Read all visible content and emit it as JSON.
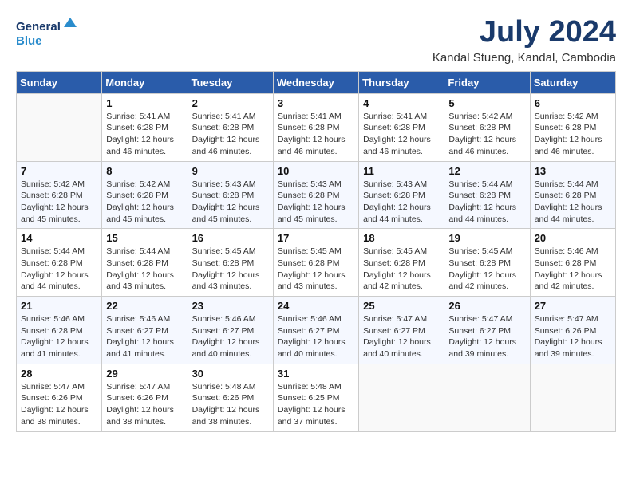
{
  "header": {
    "logo_line1": "General",
    "logo_line2": "Blue",
    "month_year": "July 2024",
    "location": "Kandal Stueng, Kandal, Cambodia"
  },
  "days_of_week": [
    "Sunday",
    "Monday",
    "Tuesday",
    "Wednesday",
    "Thursday",
    "Friday",
    "Saturday"
  ],
  "weeks": [
    [
      {
        "day": "",
        "info": ""
      },
      {
        "day": "1",
        "info": "Sunrise: 5:41 AM\nSunset: 6:28 PM\nDaylight: 12 hours\nand 46 minutes."
      },
      {
        "day": "2",
        "info": "Sunrise: 5:41 AM\nSunset: 6:28 PM\nDaylight: 12 hours\nand 46 minutes."
      },
      {
        "day": "3",
        "info": "Sunrise: 5:41 AM\nSunset: 6:28 PM\nDaylight: 12 hours\nand 46 minutes."
      },
      {
        "day": "4",
        "info": "Sunrise: 5:41 AM\nSunset: 6:28 PM\nDaylight: 12 hours\nand 46 minutes."
      },
      {
        "day": "5",
        "info": "Sunrise: 5:42 AM\nSunset: 6:28 PM\nDaylight: 12 hours\nand 46 minutes."
      },
      {
        "day": "6",
        "info": "Sunrise: 5:42 AM\nSunset: 6:28 PM\nDaylight: 12 hours\nand 46 minutes."
      }
    ],
    [
      {
        "day": "7",
        "info": "Sunrise: 5:42 AM\nSunset: 6:28 PM\nDaylight: 12 hours\nand 45 minutes."
      },
      {
        "day": "8",
        "info": "Sunrise: 5:42 AM\nSunset: 6:28 PM\nDaylight: 12 hours\nand 45 minutes."
      },
      {
        "day": "9",
        "info": "Sunrise: 5:43 AM\nSunset: 6:28 PM\nDaylight: 12 hours\nand 45 minutes."
      },
      {
        "day": "10",
        "info": "Sunrise: 5:43 AM\nSunset: 6:28 PM\nDaylight: 12 hours\nand 45 minutes."
      },
      {
        "day": "11",
        "info": "Sunrise: 5:43 AM\nSunset: 6:28 PM\nDaylight: 12 hours\nand 44 minutes."
      },
      {
        "day": "12",
        "info": "Sunrise: 5:44 AM\nSunset: 6:28 PM\nDaylight: 12 hours\nand 44 minutes."
      },
      {
        "day": "13",
        "info": "Sunrise: 5:44 AM\nSunset: 6:28 PM\nDaylight: 12 hours\nand 44 minutes."
      }
    ],
    [
      {
        "day": "14",
        "info": "Sunrise: 5:44 AM\nSunset: 6:28 PM\nDaylight: 12 hours\nand 44 minutes."
      },
      {
        "day": "15",
        "info": "Sunrise: 5:44 AM\nSunset: 6:28 PM\nDaylight: 12 hours\nand 43 minutes."
      },
      {
        "day": "16",
        "info": "Sunrise: 5:45 AM\nSunset: 6:28 PM\nDaylight: 12 hours\nand 43 minutes."
      },
      {
        "day": "17",
        "info": "Sunrise: 5:45 AM\nSunset: 6:28 PM\nDaylight: 12 hours\nand 43 minutes."
      },
      {
        "day": "18",
        "info": "Sunrise: 5:45 AM\nSunset: 6:28 PM\nDaylight: 12 hours\nand 42 minutes."
      },
      {
        "day": "19",
        "info": "Sunrise: 5:45 AM\nSunset: 6:28 PM\nDaylight: 12 hours\nand 42 minutes."
      },
      {
        "day": "20",
        "info": "Sunrise: 5:46 AM\nSunset: 6:28 PM\nDaylight: 12 hours\nand 42 minutes."
      }
    ],
    [
      {
        "day": "21",
        "info": "Sunrise: 5:46 AM\nSunset: 6:28 PM\nDaylight: 12 hours\nand 41 minutes."
      },
      {
        "day": "22",
        "info": "Sunrise: 5:46 AM\nSunset: 6:27 PM\nDaylight: 12 hours\nand 41 minutes."
      },
      {
        "day": "23",
        "info": "Sunrise: 5:46 AM\nSunset: 6:27 PM\nDaylight: 12 hours\nand 40 minutes."
      },
      {
        "day": "24",
        "info": "Sunrise: 5:46 AM\nSunset: 6:27 PM\nDaylight: 12 hours\nand 40 minutes."
      },
      {
        "day": "25",
        "info": "Sunrise: 5:47 AM\nSunset: 6:27 PM\nDaylight: 12 hours\nand 40 minutes."
      },
      {
        "day": "26",
        "info": "Sunrise: 5:47 AM\nSunset: 6:27 PM\nDaylight: 12 hours\nand 39 minutes."
      },
      {
        "day": "27",
        "info": "Sunrise: 5:47 AM\nSunset: 6:26 PM\nDaylight: 12 hours\nand 39 minutes."
      }
    ],
    [
      {
        "day": "28",
        "info": "Sunrise: 5:47 AM\nSunset: 6:26 PM\nDaylight: 12 hours\nand 38 minutes."
      },
      {
        "day": "29",
        "info": "Sunrise: 5:47 AM\nSunset: 6:26 PM\nDaylight: 12 hours\nand 38 minutes."
      },
      {
        "day": "30",
        "info": "Sunrise: 5:48 AM\nSunset: 6:26 PM\nDaylight: 12 hours\nand 38 minutes."
      },
      {
        "day": "31",
        "info": "Sunrise: 5:48 AM\nSunset: 6:25 PM\nDaylight: 12 hours\nand 37 minutes."
      },
      {
        "day": "",
        "info": ""
      },
      {
        "day": "",
        "info": ""
      },
      {
        "day": "",
        "info": ""
      }
    ]
  ]
}
